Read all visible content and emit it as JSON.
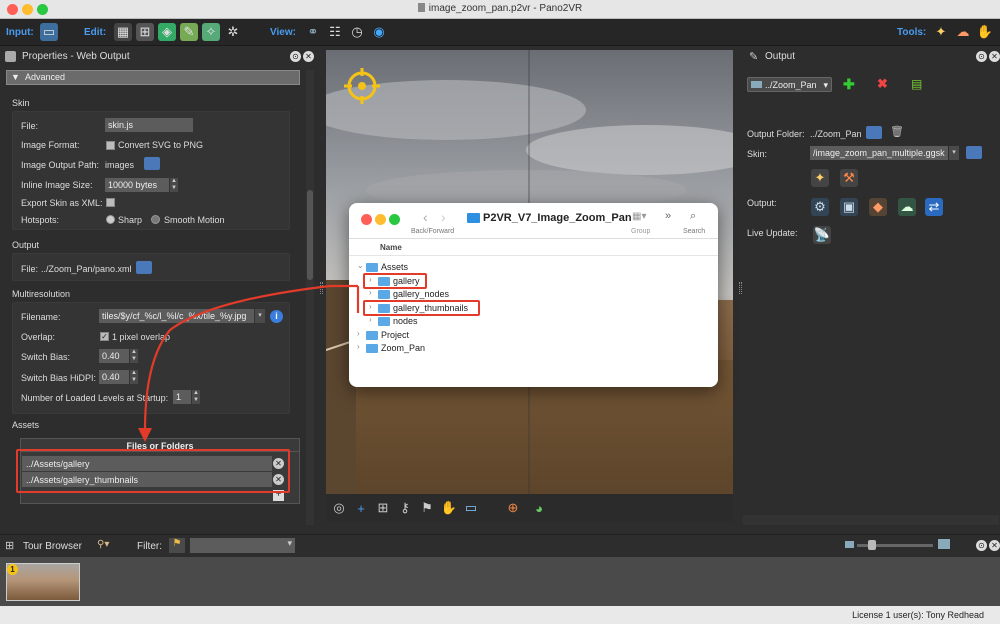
{
  "window": {
    "title": "image_zoom_pan.p2vr - Pano2VR"
  },
  "toolbar": {
    "input_label": "Input:",
    "edit_label": "Edit:",
    "view_label": "View:",
    "tools_label": "Tools:"
  },
  "properties": {
    "title": "Properties - Web Output",
    "advanced_label": "Advanced",
    "skin": {
      "section": "Skin",
      "file_label": "File:",
      "file_value": "skin.js",
      "image_format_label": "Image Format:",
      "convert_svg_label": "Convert SVG to PNG",
      "image_output_path_label": "Image Output Path:",
      "image_output_path_value": "images",
      "inline_image_size_label": "Inline Image Size:",
      "inline_image_size_value": "10000 bytes",
      "export_skin_label": "Export Skin as XML:",
      "hotspots_label": "Hotspots:",
      "hotspots_sharp": "Sharp",
      "hotspots_smooth": "Smooth Motion"
    },
    "output": {
      "section": "Output",
      "file_label": "File:",
      "file_value": "../Zoom_Pan/pano.xml"
    },
    "multires": {
      "section": "Multiresolution",
      "filename_label": "Filename:",
      "filename_value": "tiles/$y/cf_%c/l_%l/c_%x/tile_%y.jpg",
      "overlap_label": "Overlap:",
      "overlap_value": "1 pixel overlap",
      "switch_bias_label": "Switch Bias:",
      "switch_bias_value": "0.40",
      "switch_bias_hidpi_label": "Switch Bias HiDPI:",
      "switch_bias_hidpi_value": "0.40",
      "loaded_levels_label": "Number of Loaded Levels at Startup:",
      "loaded_levels_value": "1"
    },
    "assets": {
      "section": "Assets",
      "column_header": "Files or Folders",
      "items": [
        "../Assets/gallery",
        "../Assets/gallery_thumbnails"
      ]
    }
  },
  "finder": {
    "title": "P2VR_V7_Image_Zoom_Pan",
    "back_forward": "Back/Forward",
    "group": "Group",
    "search": "Search",
    "column_name": "Name",
    "rows": [
      {
        "name": "Assets",
        "level": 0,
        "open": true
      },
      {
        "name": "gallery",
        "level": 1,
        "open": false
      },
      {
        "name": "gallery_nodes",
        "level": 1,
        "open": false
      },
      {
        "name": "gallery_thumbnails",
        "level": 1,
        "open": false
      },
      {
        "name": "nodes",
        "level": 1,
        "open": false
      },
      {
        "name": "Project",
        "level": 0,
        "open": false
      },
      {
        "name": "Zoom_Pan",
        "level": 0,
        "open": false
      }
    ]
  },
  "output_panel": {
    "title": "Output",
    "selector_value": "../Zoom_Pan",
    "output_folder_label": "Output Folder:",
    "output_folder_value": "../Zoom_Pan",
    "skin_label": "Skin:",
    "skin_value": "/image_zoom_pan_multiple.ggsk",
    "output_label": "Output:",
    "live_update_label": "Live Update:"
  },
  "tour_browser": {
    "title": "Tour Browser",
    "filter_label": "Filter:",
    "thumb_badge": "1"
  },
  "status": {
    "license": "License 1 user(s): Tony Redhead"
  },
  "colors": {
    "accent": "#4a9cf0",
    "highlight": "#e23b2a",
    "folder": "#5aa9e6"
  }
}
